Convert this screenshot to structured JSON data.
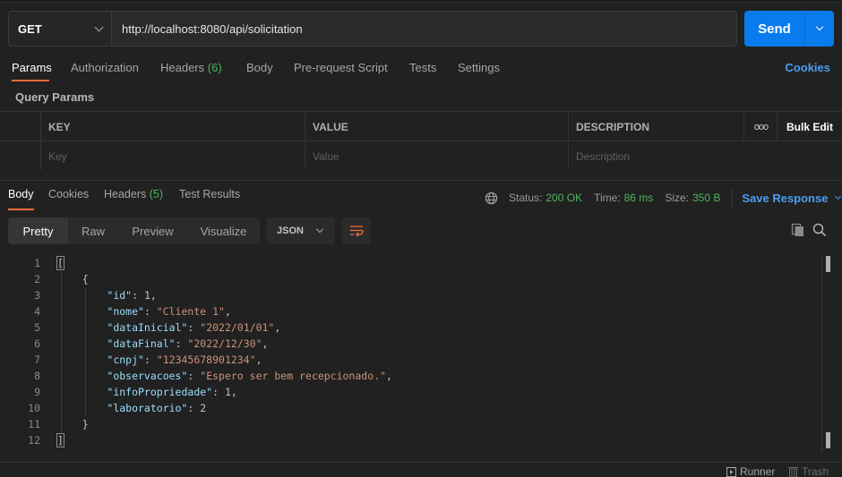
{
  "request": {
    "method": "GET",
    "url": "http://localhost:8080/api/solicitation",
    "send_label": "Send"
  },
  "request_tabs": [
    {
      "label": "Params",
      "active": true
    },
    {
      "label": "Authorization"
    },
    {
      "label": "Headers",
      "count": "(6)"
    },
    {
      "label": "Body"
    },
    {
      "label": "Pre-request Script"
    },
    {
      "label": "Tests"
    },
    {
      "label": "Settings"
    }
  ],
  "cookies_label": "Cookies",
  "query_params": {
    "title": "Query Params",
    "columns": [
      "KEY",
      "VALUE",
      "DESCRIPTION"
    ],
    "more_label": "ooo",
    "bulk_edit_label": "Bulk Edit",
    "placeholders": {
      "key": "Key",
      "value": "Value",
      "description": "Description"
    }
  },
  "response_tabs": [
    {
      "label": "Body",
      "active": true
    },
    {
      "label": "Cookies"
    },
    {
      "label": "Headers",
      "count": "(5)"
    },
    {
      "label": "Test Results"
    }
  ],
  "response_meta": {
    "status_label": "Status:",
    "status_value": "200 OK",
    "time_label": "Time:",
    "time_value": "86 ms",
    "size_label": "Size:",
    "size_value": "350 B",
    "save_label": "Save Response"
  },
  "view_modes": [
    "Pretty",
    "Raw",
    "Preview",
    "Visualize"
  ],
  "active_view": "Pretty",
  "format": "JSON",
  "colors": {
    "accent": "#f26b3a",
    "send": "#097bed",
    "link": "#4a9df0",
    "success": "#4fb35e"
  },
  "body_lines": [
    {
      "n": "1",
      "tokens": [
        [
          "p",
          "["
        ]
      ]
    },
    {
      "n": "2",
      "tokens": [
        [
          "p",
          "    {"
        ]
      ]
    },
    {
      "n": "3",
      "tokens": [
        [
          "p",
          "        "
        ],
        [
          "k",
          "\"id\""
        ],
        [
          "p",
          ": "
        ],
        [
          "n",
          "1"
        ],
        [
          "p",
          ","
        ]
      ]
    },
    {
      "n": "4",
      "tokens": [
        [
          "p",
          "        "
        ],
        [
          "k",
          "\"nome\""
        ],
        [
          "p",
          ": "
        ],
        [
          "s",
          "\"Cliente 1\""
        ],
        [
          "p",
          ","
        ]
      ]
    },
    {
      "n": "5",
      "tokens": [
        [
          "p",
          "        "
        ],
        [
          "k",
          "\"dataInicial\""
        ],
        [
          "p",
          ": "
        ],
        [
          "s",
          "\"2022/01/01\""
        ],
        [
          "p",
          ","
        ]
      ]
    },
    {
      "n": "6",
      "tokens": [
        [
          "p",
          "        "
        ],
        [
          "k",
          "\"dataFinal\""
        ],
        [
          "p",
          ": "
        ],
        [
          "s",
          "\"2022/12/30\""
        ],
        [
          "p",
          ","
        ]
      ]
    },
    {
      "n": "7",
      "tokens": [
        [
          "p",
          "        "
        ],
        [
          "k",
          "\"cnpj\""
        ],
        [
          "p",
          ": "
        ],
        [
          "s",
          "\"12345678901234\""
        ],
        [
          "p",
          ","
        ]
      ]
    },
    {
      "n": "8",
      "tokens": [
        [
          "p",
          "        "
        ],
        [
          "k",
          "\"observacoes\""
        ],
        [
          "p",
          ": "
        ],
        [
          "s",
          "\"Espero ser bem recepcionado.\""
        ],
        [
          "p",
          ","
        ]
      ]
    },
    {
      "n": "9",
      "tokens": [
        [
          "p",
          "        "
        ],
        [
          "k",
          "\"infoPropriedade\""
        ],
        [
          "p",
          ": "
        ],
        [
          "n",
          "1"
        ],
        [
          "p",
          ","
        ]
      ]
    },
    {
      "n": "10",
      "tokens": [
        [
          "p",
          "        "
        ],
        [
          "k",
          "\"laboratorio\""
        ],
        [
          "p",
          ": "
        ],
        [
          "n",
          "2"
        ]
      ]
    },
    {
      "n": "11",
      "tokens": [
        [
          "p",
          "    }"
        ]
      ]
    },
    {
      "n": "12",
      "tokens": [
        [
          "p",
          "]"
        ]
      ]
    }
  ],
  "statusbar": {
    "runner_label": "Runner",
    "trash_label": "Trash"
  }
}
